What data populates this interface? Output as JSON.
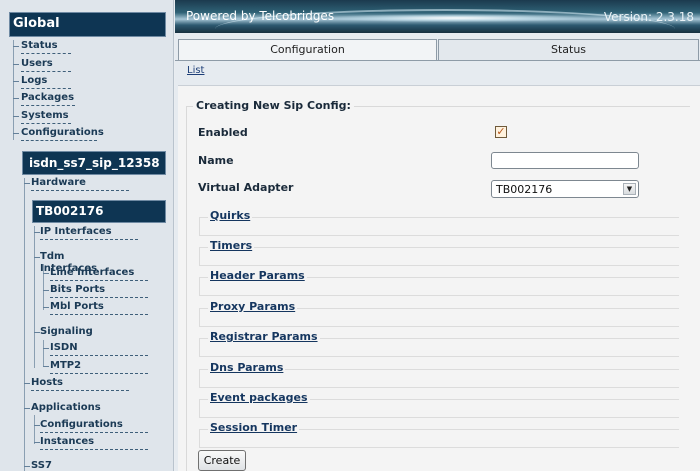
{
  "sidebar": {
    "global_title": "Global",
    "global_items": [
      "Status",
      "Users",
      "Logs",
      "Packages",
      "Systems",
      "Configurations"
    ],
    "config_title": "isdn_ss7_sip_12358",
    "hardware": "Hardware",
    "adapter_title": "TB002176",
    "ip_interfaces": "IP Interfaces",
    "tdm_interfaces": "Tdm Interfaces",
    "tdm_children": [
      "Line Interfaces",
      "Bits Ports",
      "Mbl Ports"
    ],
    "signaling": "Signaling",
    "signaling_children": [
      "ISDN",
      "MTP2"
    ],
    "hosts": "Hosts",
    "applications": "Applications",
    "application_children": [
      "Configurations",
      "Instances"
    ],
    "ss7": "SS7"
  },
  "header": {
    "powered_by": "Powered by Telcobridges",
    "version": "Version: 2.3.18"
  },
  "tabs": [
    {
      "label": "Configuration",
      "active": true
    },
    {
      "label": "Status",
      "active": false
    }
  ],
  "list_link": "List",
  "form": {
    "legend": "Creating New Sip Config:",
    "enabled_label": "Enabled",
    "enabled_checked": true,
    "enabled_mark": "✓",
    "name_label": "Name",
    "name_value": "",
    "adapter_label": "Virtual Adapter",
    "adapter_value": "TB002176",
    "sections": [
      "Quirks",
      "Timers",
      "Header Params",
      "Proxy Params",
      "Registrar Params",
      "Dns Params",
      "Event packages",
      "Session Timer"
    ],
    "create_label": "Create"
  },
  "colors": {
    "sidebar_header_bg": "#0e3553",
    "link": "#15365f",
    "checkbox_mark": "#b4551c"
  }
}
